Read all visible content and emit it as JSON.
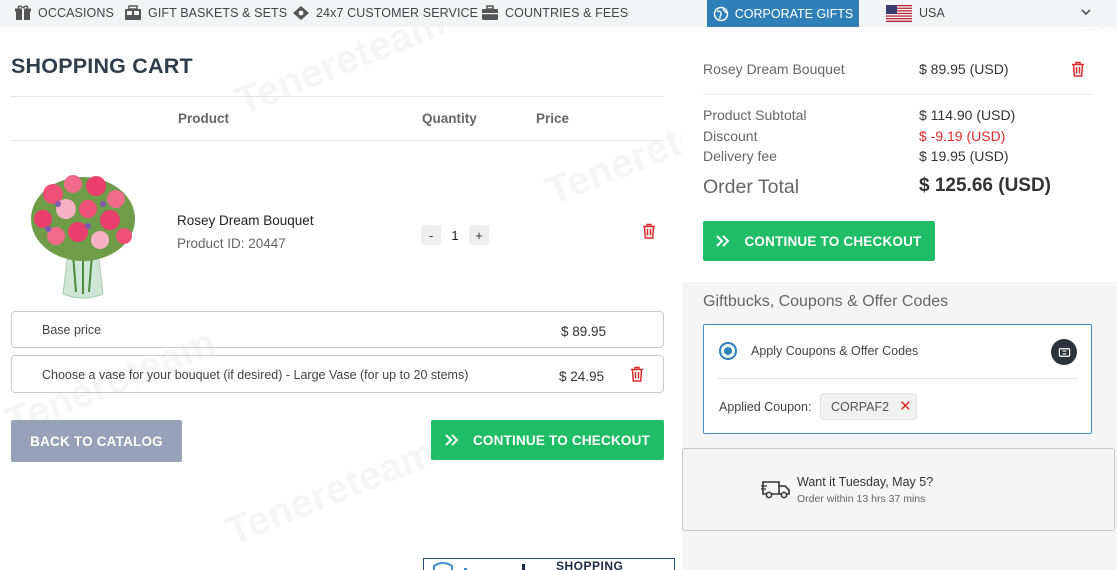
{
  "topnav": {
    "items": [
      {
        "label": "OCCASIONS",
        "icon": "gift-box-icon"
      },
      {
        "label": "GIFT BASKETS & SETS",
        "icon": "basket-icon"
      },
      {
        "label": "24x7 CUSTOMER SERVICE",
        "icon": "handshake-icon"
      },
      {
        "label": "COUNTRIES & FEES",
        "icon": "briefcase-icon"
      }
    ],
    "corporate_label": "CORPORATE GIFTS",
    "country": "USA"
  },
  "cart": {
    "title": "SHOPPING CART",
    "headers": {
      "product": "Product",
      "quantity": "Quantity",
      "price": "Price"
    },
    "item": {
      "name": "Rosey Dream Bouquet",
      "product_id": "Product ID: 20447",
      "quantity": "1",
      "minus": "-",
      "plus": "+"
    },
    "lines": [
      {
        "label": "Base price",
        "price": "$ 89.95"
      },
      {
        "label": "Choose a vase for your bouquet (if desired) - Large Vase (for up to 20 stems)",
        "price": "$ 24.95"
      }
    ],
    "back_label": "BACK TO CATALOG",
    "checkout_label": "CONTINUE TO CHECKOUT"
  },
  "summary": {
    "item_name": "Rosey Dream Bouquet",
    "item_price": "$ 89.95 (USD)",
    "rows": [
      {
        "label": "Product Subtotal",
        "value": "$ 114.90 (USD)"
      },
      {
        "label": "Discount",
        "value": "$ -9.19 (USD)"
      },
      {
        "label": "Delivery fee",
        "value": "$ 19.95 (USD)"
      }
    ],
    "total_label": "Order Total",
    "total_value": "$ 125.66 (USD)",
    "checkout_label": "CONTINUE TO CHECKOUT"
  },
  "coupons": {
    "title": "Giftbucks, Coupons & Offer Codes",
    "apply_label": "Apply Coupons & Offer Codes",
    "applied_label": "Applied Coupon:",
    "code": "CORPAF2",
    "remove": "✕"
  },
  "delivery": {
    "headline": "Want it Tuesday, May 5?",
    "detail": "Order within 13 hrs 37 mins"
  },
  "banner": {
    "text": "SHOPPING"
  },
  "colors": {
    "accent_blue": "#2f80b8",
    "checkout_green": "#20bd67",
    "back_button": "#97a2b8",
    "discount_red": "#e02b2b",
    "trash_red": "#e02b2b"
  }
}
